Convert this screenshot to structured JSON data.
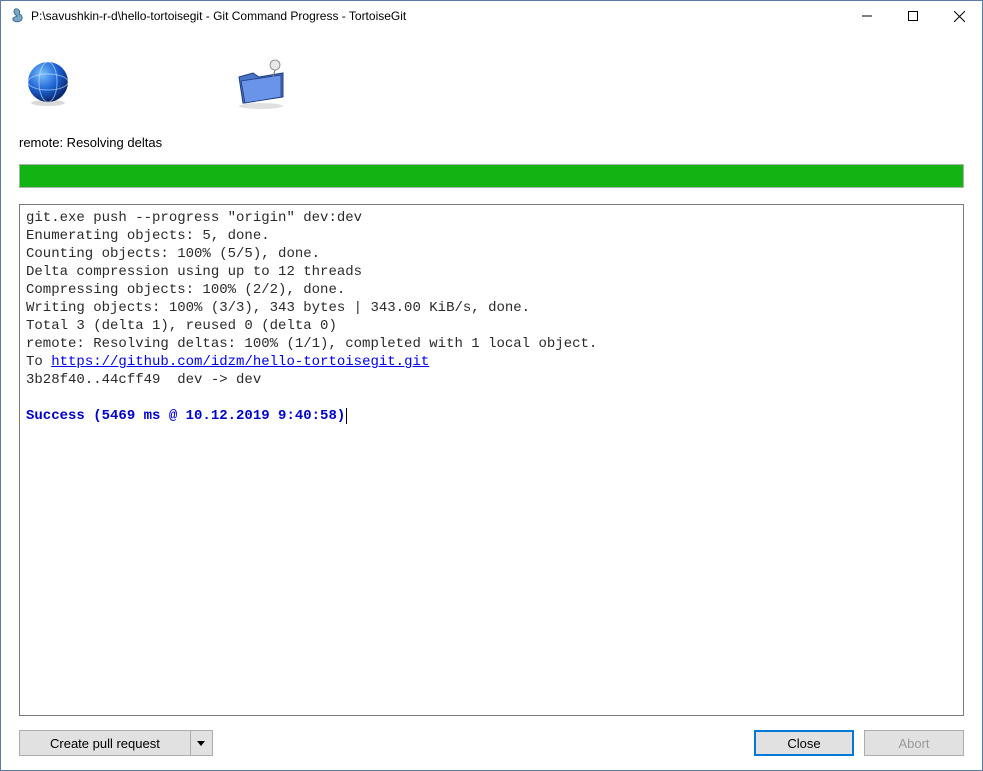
{
  "titlebar": {
    "title": "P:\\savushkin-r-d\\hello-tortoisegit - Git Command Progress - TortoiseGit"
  },
  "status_label": "remote: Resolving deltas",
  "log": {
    "lines": [
      "git.exe push --progress \"origin\" dev:dev",
      "Enumerating objects: 5, done.",
      "Counting objects: 100% (5/5), done.",
      "Delta compression using up to 12 threads",
      "Compressing objects: 100% (2/2), done.",
      "Writing objects: 100% (3/3), 343 bytes | 343.00 KiB/s, done.",
      "Total 3 (delta 1), reused 0 (delta 0)",
      "remote: Resolving deltas: 100% (1/1), completed with 1 local object."
    ],
    "link_prefix": "To ",
    "link_url": "https://github.com/idzm/hello-tortoisegit.git",
    "ref_line": "3b28f40..44cff49  dev -> dev",
    "success": "Success (5469 ms @ 10.12.2019 9:40:58)"
  },
  "buttons": {
    "create_pr": "Create pull request",
    "close": "Close",
    "abort": "Abort"
  }
}
